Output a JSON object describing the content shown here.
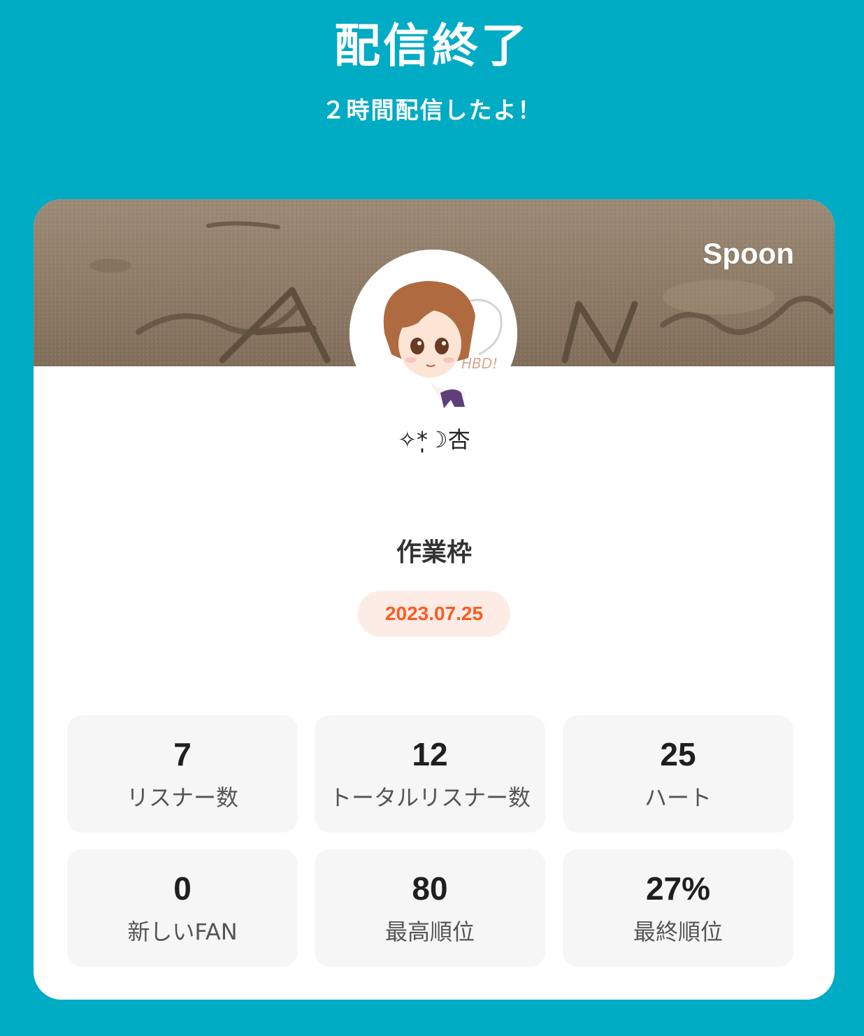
{
  "header": {
    "title": "配信終了",
    "subtitle": "２時間配信したよ！"
  },
  "card": {
    "brand": "Spoon",
    "banner_text": "AN",
    "avatar_text": "HBD!",
    "username": "✧*̣̩☽杏",
    "live_title": "作業枠",
    "date": "2023.07.25",
    "stats": [
      {
        "value": "7",
        "label": "リスナー数"
      },
      {
        "value": "12",
        "label": "トータルリスナー数"
      },
      {
        "value": "25",
        "label": "ハート"
      },
      {
        "value": "0",
        "label": "新しいFAN"
      },
      {
        "value": "80",
        "label": "最高順位"
      },
      {
        "value": "27%",
        "label": "最終順位"
      }
    ]
  },
  "colors": {
    "background": "#00abc4",
    "date_text": "#ff5a1f",
    "date_badge": "#fdece6",
    "stat_tile": "#f6f6f6"
  }
}
